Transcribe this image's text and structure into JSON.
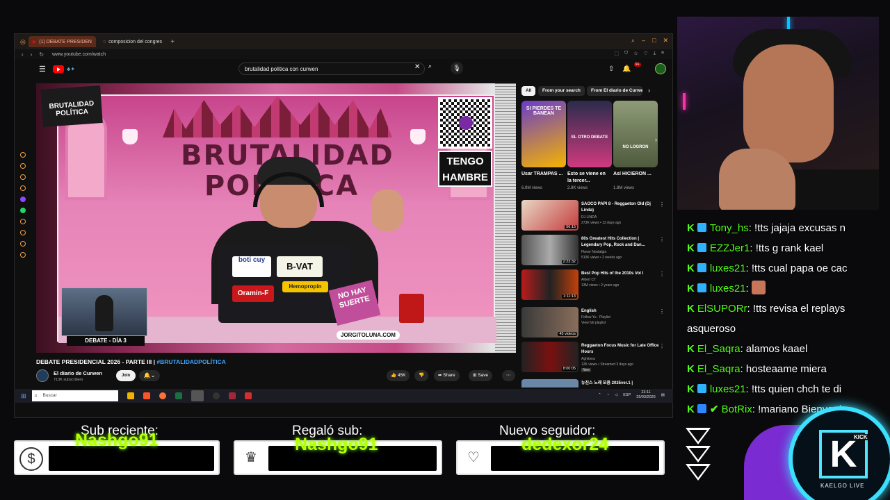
{
  "browser": {
    "tabs": [
      {
        "label": "(1) DEBATE PRESIDEN",
        "active": true
      },
      {
        "label": "composicion del congres",
        "active": false
      }
    ],
    "new_tab": "+",
    "url": "www.youtube.com/watch"
  },
  "youtube": {
    "search_value": "brutalidad politica con curwen",
    "notification_count": "9+",
    "video": {
      "show_logo": "BRUTALIDAD POLÍTICA",
      "set_title_line1": "BRUTALIDAD",
      "set_title_line2": "POLÍTICA",
      "tengo_line1": "TENGO",
      "tengo_line2": "HAMBRE",
      "pip_label": "DEBATE - DÍA 3",
      "handle": "JORGITOLUNA.COM",
      "sign_text": "NO HAY SUERTE",
      "laptop_stickers": [
        "boti cuy",
        "B-VAT",
        "Oramin-F",
        "Hemopropin"
      ]
    },
    "title_main": "DEBATE PRESIDENCIAL 2026 - PARTE III | ",
    "title_tag": "#BRUTALIDADPOLÍTICA",
    "channel_name": "El diario de Curwen",
    "channel_subs": "713K subscribers",
    "join_label": "Join",
    "likes": "45K",
    "share_label": "Share",
    "save_label": "Save",
    "chips": [
      "All",
      "From your search",
      "From El diario de Curwe"
    ],
    "shorts": [
      {
        "title": "Usar TRAMPAS ...",
        "views": "6.9M views",
        "overlay": "SI PIERDES TE BANEAN"
      },
      {
        "title": "Esto se viene en la tercer...",
        "views": "2.8K views",
        "overlay": "EL OTRO DEBATE"
      },
      {
        "title": "Así HICIERON ...",
        "views": "1.8M views",
        "overlay": "NO LOGRON"
      }
    ],
    "recommendations": [
      {
        "title": "SAOCO PAPI 8 - Reggaeton Old (Dj Linda)",
        "channel": "DJ LINDA",
        "meta": "273K views • 13 days ago",
        "duration": "56:15"
      },
      {
        "title": "80s Greatest Hits Collection | Legendary Pop, Rock and Dan...",
        "channel": "Flavor Nostalgia",
        "meta": "510K views • 2 weeks ago",
        "duration": "2:23:32"
      },
      {
        "title": "Best Pop Hits of the 2010s Vol I",
        "channel": "Albert CT",
        "meta": "13M views • 2 years ago",
        "duration": "1:11:13"
      },
      {
        "title": "English",
        "channel": "Follow Yu · Playlist",
        "meta": "View full playlist",
        "duration": "45 videos"
      },
      {
        "title": "Reggaeton Focus Music for Late Office Hours",
        "channel": "Aghitona",
        "meta": "12K views • Streamed 3 days ago",
        "duration": "8:00:05",
        "badge": "New"
      },
      {
        "title": "뉴진스 노래 모음 2025ver.1 |",
        "channel": "",
        "meta": "",
        "duration": ""
      }
    ]
  },
  "taskbar": {
    "search_placeholder": "Buscar",
    "lang": "ESP",
    "time": "23:11",
    "date": "25/03/2026"
  },
  "chat": [
    {
      "user": "Tony_hs",
      "text": ": !tts jajaja excusas n",
      "badge": true
    },
    {
      "user": "EZZJer1",
      "text": ": !tts g rank kael",
      "badge": true
    },
    {
      "user": "luxes21",
      "text": ": !tts cual papa oe cac",
      "badge": true
    },
    {
      "user": "luxes21",
      "text": ": ",
      "badge": true,
      "emote": true
    },
    {
      "user": "ElSUPORr",
      "text": ": !tts revisa el replays",
      "badge": false
    },
    {
      "user": "",
      "text": "asqueroso",
      "badge": false,
      "continuation": true
    },
    {
      "user": "El_Saqra",
      "text": ": alamos kaael",
      "badge": false
    },
    {
      "user": "El_Saqra",
      "text": ": hosteaame miera",
      "badge": false
    },
    {
      "user": "luxes21",
      "text": ": !tts quien chch te di",
      "badge": true
    },
    {
      "user": "BotRix",
      "text": ": !mariano Bienvenic",
      "badge": false,
      "bot": true
    }
  ],
  "alerts": [
    {
      "label": "Sub reciente:",
      "name": "Nashgo91",
      "icon": "dollar-icon"
    },
    {
      "label": "Regaló sub:",
      "name": "Nashgo91",
      "icon": "crown-icon"
    },
    {
      "label": "Nuevo seguidor:",
      "name": "dedexor24",
      "icon": "heart-icon"
    }
  ],
  "logo": {
    "kick": "KICK",
    "name": "KAELGO LIVE"
  },
  "colors": {
    "kick_green": "#53fc18",
    "yt_red": "#ff0000",
    "link_blue": "#3ea6ff",
    "alert_name": "#b8ff00",
    "logo_cyan": "#3be0ff"
  }
}
